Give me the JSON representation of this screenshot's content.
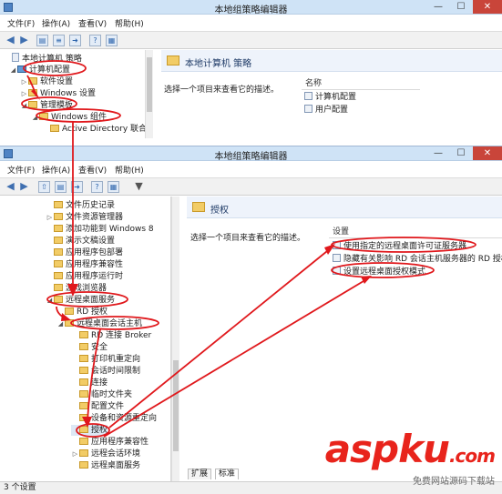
{
  "app": {
    "title": "本地组策略编辑器",
    "menus": [
      "文件(F)",
      "操作(A)",
      "查看(V)",
      "帮助(H)"
    ],
    "controls": {
      "minimize": "—",
      "maximize": "☐",
      "close": "✕"
    }
  },
  "window1": {
    "tree": [
      {
        "label": "本地计算机 策略",
        "expander": "",
        "icon": "doc"
      },
      {
        "label": "计算机配置",
        "expander": "◢",
        "icon": "pc"
      },
      {
        "label": "软件设置",
        "expander": "▷",
        "icon": "folder"
      },
      {
        "label": "Windows 设置",
        "expander": "▷",
        "icon": "folder"
      },
      {
        "label": "管理模板",
        "expander": "◢",
        "icon": "folder"
      },
      {
        "label": "Windows 组件",
        "expander": "◢",
        "icon": "folder"
      },
      {
        "label": "Active Directory 联合",
        "expander": "",
        "icon": "folder"
      }
    ],
    "header": "本地计算机 策略",
    "hint": "选择一个项目来查看它的描述。",
    "column": "名称",
    "items": [
      "计算机配置",
      "用户配置"
    ]
  },
  "window2": {
    "tree": [
      {
        "label": "文件历史记录",
        "expander": "",
        "icon": "folder"
      },
      {
        "label": "文件资源管理器",
        "expander": "▷",
        "icon": "folder"
      },
      {
        "label": "添加功能到 Windows 8",
        "expander": "",
        "icon": "folder"
      },
      {
        "label": "演示文稿设置",
        "expander": "",
        "icon": "folder"
      },
      {
        "label": "应用程序包部署",
        "expander": "",
        "icon": "folder"
      },
      {
        "label": "应用程序兼容性",
        "expander": "",
        "icon": "folder"
      },
      {
        "label": "应用程序运行时",
        "expander": "",
        "icon": "folder"
      },
      {
        "label": "游戏浏览器",
        "expander": "",
        "icon": "folder"
      },
      {
        "label": "远程桌面服务",
        "expander": "◢",
        "icon": "folder"
      },
      {
        "label": "RD 授权",
        "expander": "",
        "icon": "folder"
      },
      {
        "label": "远程桌面会话主机",
        "expander": "◢",
        "icon": "folder"
      },
      {
        "label": "RD 连接 Broker",
        "expander": "",
        "icon": "folder"
      },
      {
        "label": "安全",
        "expander": "",
        "icon": "folder"
      },
      {
        "label": "打印机重定向",
        "expander": "",
        "icon": "folder"
      },
      {
        "label": "会话时间限制",
        "expander": "",
        "icon": "folder"
      },
      {
        "label": "连接",
        "expander": "",
        "icon": "folder"
      },
      {
        "label": "临时文件夹",
        "expander": "",
        "icon": "folder"
      },
      {
        "label": "配置文件",
        "expander": "",
        "icon": "folder"
      },
      {
        "label": "设备和资源重定向",
        "expander": "",
        "icon": "folder"
      },
      {
        "label": "授权",
        "expander": "",
        "icon": "folder"
      },
      {
        "label": "应用程序兼容性",
        "expander": "",
        "icon": "folder"
      },
      {
        "label": "远程会话环境",
        "expander": "▷",
        "icon": "folder"
      },
      {
        "label": "远程桌面服务",
        "expander": "",
        "icon": "folder"
      }
    ],
    "header": "授权",
    "hint": "选择一个项目来查看它的描述。",
    "column": "设置",
    "items": [
      "使用指定的远程桌面许可证服务器",
      "隐藏有关影响 RD 会话主机服务器的 RD 授权",
      "设置远程桌面授权模式"
    ],
    "tabs": [
      "扩展",
      "标准"
    ],
    "status": "3 个设置"
  },
  "watermark": {
    "main": "aspku",
    "dotcom": ".com",
    "sub": "免费网站源码下载站"
  },
  "colors": {
    "annotation": "#e0181c",
    "watermark": "#e8241c",
    "header_bg": "#eef3fb"
  }
}
